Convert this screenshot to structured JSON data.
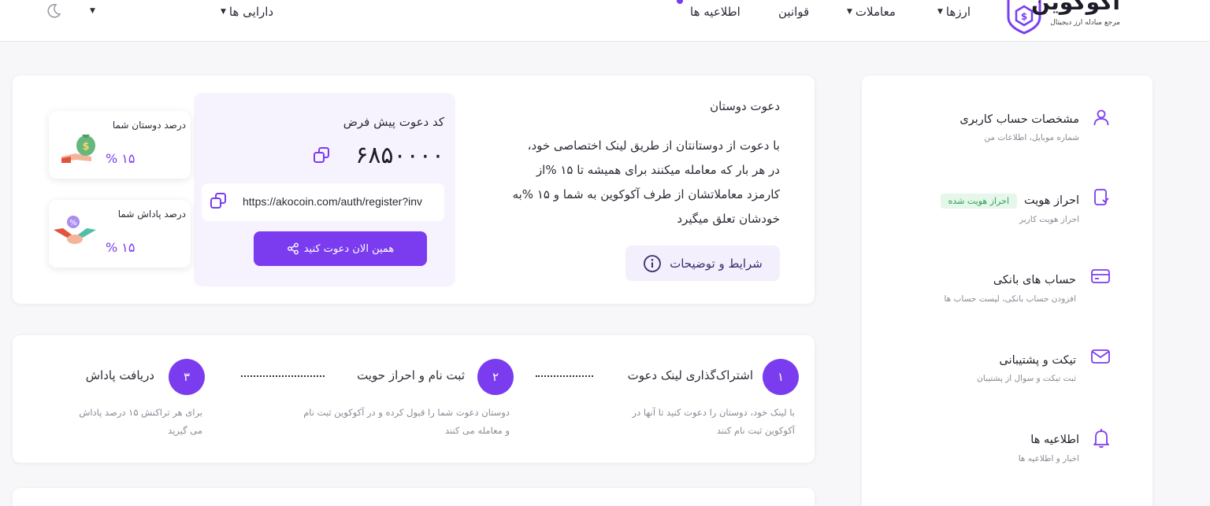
{
  "header": {
    "logo_name": "آکوکوین",
    "logo_tagline": "مرجع مبادله ارز دیجیتال",
    "nav": {
      "currencies": "ارزها",
      "trades": "معاملات",
      "rules": "قوانین",
      "announcements": "اطلاعیه ها",
      "assets": "دارایی ها"
    }
  },
  "sidebar": {
    "items": [
      {
        "title": "مشخصات حساب کاربری",
        "sub": "شماره موبایل، اطلاعات من",
        "icon": "user-icon"
      },
      {
        "title": "احراز هویت",
        "sub": "احراز هویت کاربر",
        "icon": "id-verify-icon",
        "badge": "احراز هویت شده"
      },
      {
        "title": "حساب های بانکی",
        "sub": "افزودن حساب بانکی، لیست حساب ها",
        "icon": "credit-card-icon"
      },
      {
        "title": "تیکت و پشتیبانی",
        "sub": "ثبت تیکت و سوال از پشتیبان",
        "icon": "envelope-icon"
      },
      {
        "title": "اطلاعیه ها",
        "sub": "اخبار و اطلاعیه ها",
        "icon": "bell-icon"
      }
    ]
  },
  "invite": {
    "title": "دعوت دوستان",
    "description_lines": [
      "با دعوت از دوستانتان از طریق لینک اختصاصی خود،",
      "در هر بار که معامله میکنند برای همیشه تا ۱۵ %از",
      "کارمزد معاملاتشان از طرف آکوکوین به شما و ۱۵ %به",
      "خودشان تعلق میگیرد"
    ],
    "terms_label": "شرایط و توضیحات",
    "code_label": "کد دعوت پیش فرض",
    "code_value": "۶۸۵۰۰۰۰",
    "link_value": "https://akocoin.com/auth/register?inv",
    "invite_button": "همین الان دعوت کنید",
    "friends_percent_label": "درصد دوستان شما",
    "friends_percent_value": "۱۵ %",
    "reward_percent_label": "درصد پاداش شما",
    "reward_percent_value": "۱۵ %"
  },
  "steps": [
    {
      "number": "۱",
      "title": "اشتراک‌گذاری لینک دعوت",
      "desc_lines": [
        "با لینک خود، دوستان را دعوت کنید تا آنها در",
        "آکوکوین ثبت نام کنند"
      ]
    },
    {
      "number": "۲",
      "title": "ثبت نام و احراز حویت",
      "desc_lines": [
        "دوستان دعوت شما را قبول کرده و در آکوکوین ثبت نام",
        "و معامله می کنند"
      ]
    },
    {
      "number": "۳",
      "title": "دریافت پاداش",
      "desc_lines": [
        "برای هر تراکنش ۱۵ درصد پاداش",
        "می گیرید"
      ]
    }
  ],
  "colors": {
    "accent": "#7b3cf0",
    "badge_bg": "#e5f6ea",
    "badge_text": "#2e9d52",
    "page_bg": "#f7f7f9"
  }
}
